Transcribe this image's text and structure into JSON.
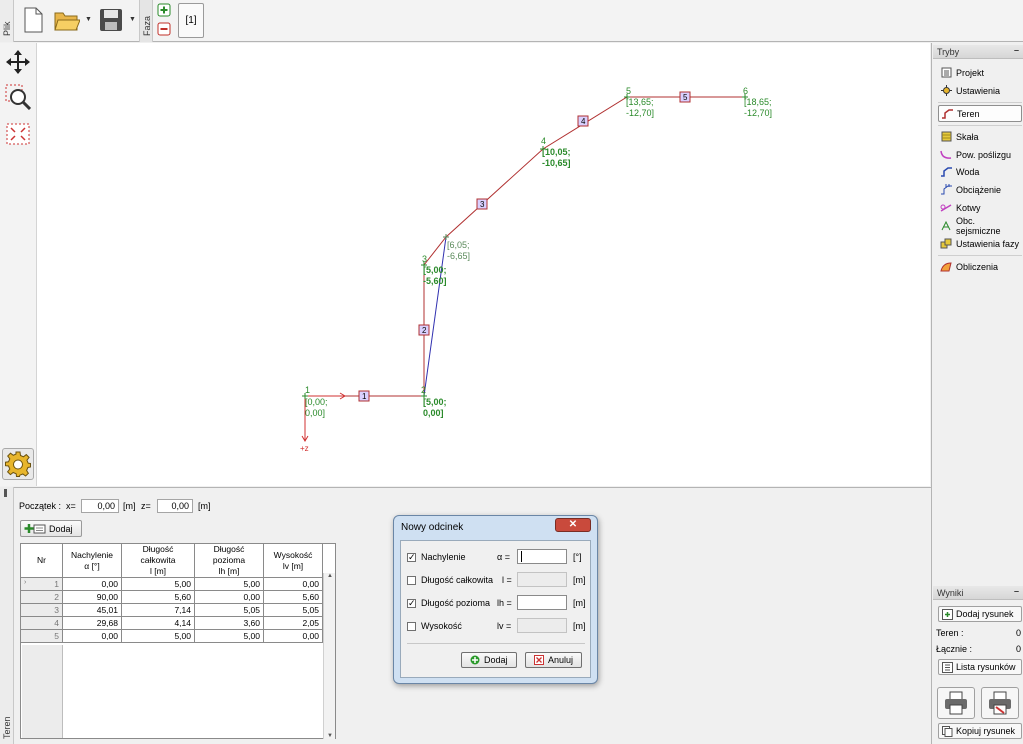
{
  "toolbar": {
    "file_tab": "Plik",
    "phase_tab": "Faza",
    "phase_button": "[1]",
    "icons": [
      "new-file-icon",
      "open-folder-icon",
      "save-disk-icon",
      "add-phase-icon",
      "remove-phase-icon"
    ]
  },
  "left_tools": [
    "move-icon",
    "zoom-icon",
    "fit-view-icon",
    "settings-gear-icon"
  ],
  "canvas": {
    "points": [
      {
        "nr": "1",
        "coord": [
          "[0,00;",
          "0,00]"
        ]
      },
      {
        "nr": "2",
        "coord": [
          "[5,00;",
          "0,00]"
        ]
      },
      {
        "nr": "3",
        "coord": [
          "[5,00;",
          "-5,60]"
        ]
      },
      {
        "nr": "4",
        "coord": [
          "[10,05;",
          "-10,65]"
        ]
      },
      {
        "nr": "5",
        "coord": [
          "[13,65;",
          "-12,70]"
        ]
      },
      {
        "nr": "6",
        "coord": [
          "[18,65;",
          "-12,70]"
        ]
      },
      {
        "nr": "",
        "coord": [
          "[6,05;",
          "-6,65]"
        ]
      }
    ],
    "segments": [
      "1",
      "2",
      "3",
      "4",
      "5"
    ],
    "z_axis_label": "+z"
  },
  "right_panel": {
    "modes_header": "Tryby",
    "modes": [
      {
        "label": "Projekt",
        "icon": "project-icon"
      },
      {
        "label": "Ustawienia",
        "icon": "settings-sun-icon"
      },
      {
        "label": "Teren",
        "icon": "terrain-icon",
        "active": true
      },
      {
        "label": "Skała",
        "icon": "rock-icon"
      },
      {
        "label": "Pow. poślizgu",
        "icon": "slip-surface-icon"
      },
      {
        "label": "Woda",
        "icon": "water-icon"
      },
      {
        "label": "Obciążenie",
        "icon": "load-icon"
      },
      {
        "label": "Kotwy",
        "icon": "anchors-icon"
      },
      {
        "label": "Obc. sejsmiczne",
        "icon": "seismic-icon"
      },
      {
        "label": "Ustawienia fazy",
        "icon": "phase-settings-icon"
      },
      {
        "label": "Obliczenia",
        "icon": "calculation-icon"
      }
    ],
    "results_header": "Wyniki",
    "add_drawing": "Dodaj rysunek",
    "teren_label": "Teren :",
    "teren_value": "0",
    "total_label": "Łącznie :",
    "total_value": "0",
    "list_drawings": "Lista rysunków",
    "copy_drawing": "Kopiuj rysunek"
  },
  "bottom": {
    "side_tab": "Teren",
    "start_label": "Początek :",
    "x_label": "x=",
    "x_value": "0,00",
    "z_label": "z=",
    "z_value": "0,00",
    "unit": "[m]",
    "add_button": "Dodaj",
    "table": {
      "headers": [
        {
          "line1": "Nr",
          "line2": ""
        },
        {
          "line1": "Nachylenie",
          "line2": "α [°]"
        },
        {
          "line1": "Długość całkowita",
          "line2": "l [m]"
        },
        {
          "line1": "Długość pozioma",
          "line2": "lh [m]"
        },
        {
          "line1": "Wysokość",
          "line2": "lv [m]"
        }
      ],
      "rows": [
        [
          "1",
          "0,00",
          "5,00",
          "5,00",
          "0,00"
        ],
        [
          "2",
          "90,00",
          "5,60",
          "0,00",
          "5,60"
        ],
        [
          "3",
          "45,01",
          "7,14",
          "5,05",
          "5,05"
        ],
        [
          "4",
          "29,68",
          "4,14",
          "3,60",
          "2,05"
        ],
        [
          "5",
          "0,00",
          "5,00",
          "5,00",
          "0,00"
        ]
      ]
    }
  },
  "dialog": {
    "title": "Nowy odcinek",
    "close": "✕",
    "rows": [
      {
        "label": "Nachylenie",
        "checked": true,
        "sym": "α =",
        "unit": "[°]",
        "enabled": true
      },
      {
        "label": "Długość całkowita",
        "checked": false,
        "sym": "l =",
        "unit": "[m]",
        "enabled": false
      },
      {
        "label": "Długość pozioma",
        "checked": true,
        "sym": "lh =",
        "unit": "[m]",
        "enabled": true
      },
      {
        "label": "Wysokość",
        "checked": false,
        "sym": "lv =",
        "unit": "[m]",
        "enabled": false
      }
    ],
    "add_button": "Dodaj",
    "cancel_button": "Anuluj"
  }
}
